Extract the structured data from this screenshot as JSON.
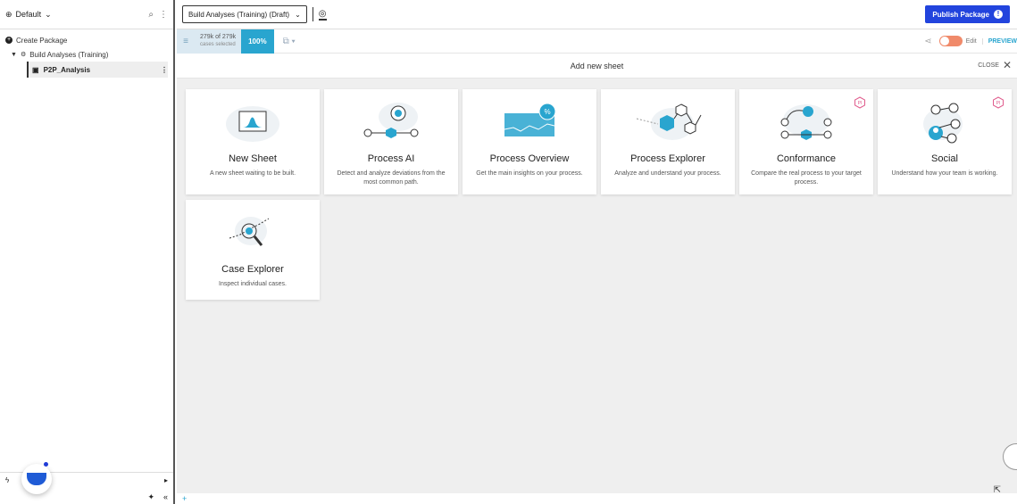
{
  "sidebar": {
    "workspace": "Default",
    "create_package": "Create Package",
    "tree_item": "Build Analyses (Training)",
    "sheet_item": "P2P_Analysis",
    "bottom_label": "ion"
  },
  "topbar": {
    "app_select": "Build Analyses (Training) (Draft)",
    "publish_label": "Publish Package"
  },
  "subbar": {
    "cases_count": "279k of 279k",
    "cases_sub": "cases selected",
    "percent": "100%",
    "edit_label": "Edit",
    "preview_label": "PREVIEW"
  },
  "sheet": {
    "title": "Add new sheet",
    "close_label": "CLOSE"
  },
  "cards": [
    {
      "title": "New Sheet",
      "desc": "A new sheet waiting to be built."
    },
    {
      "title": "Process AI",
      "desc": "Detect and analyze deviations from the most common path."
    },
    {
      "title": "Process Overview",
      "desc": "Get the main insights on your process."
    },
    {
      "title": "Process Explorer",
      "desc": "Analyze and understand your process."
    },
    {
      "title": "Conformance",
      "desc": "Compare the real process to your target process."
    },
    {
      "title": "Social",
      "desc": "Understand how your team is working."
    },
    {
      "title": "Case Explorer",
      "desc": "Inspect individual cases."
    }
  ],
  "colors": {
    "accent": "#29a5cf",
    "publish": "#2244dd",
    "toggle": "#f08a6a"
  }
}
